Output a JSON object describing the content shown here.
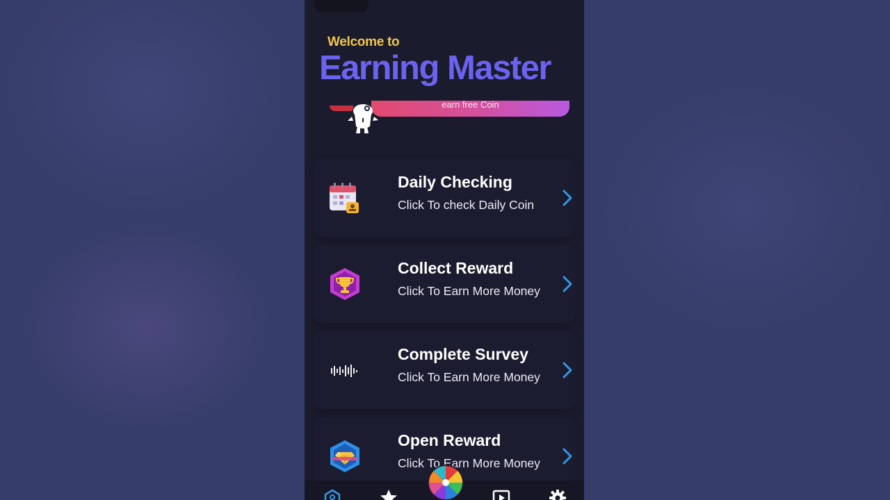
{
  "header": {
    "welcome": "Welcome to",
    "title": "Earning Master"
  },
  "banner": {
    "text": "earn free Coin"
  },
  "menu": [
    {
      "title": "Daily Checking",
      "subtitle": "Click To check Daily Coin",
      "icon": "calendar-icon"
    },
    {
      "title": "Collect Reward",
      "subtitle": "Click To Earn More Money",
      "icon": "trophy-badge-icon"
    },
    {
      "title": "Complete Survey",
      "subtitle": "Click To Earn More Money",
      "icon": "survey-waveform-icon"
    },
    {
      "title": "Open Reward",
      "subtitle": "Click To Earn More Money",
      "icon": "diamond-badge-icon"
    }
  ],
  "bottom_nav": {
    "items": [
      "home-icon",
      "star-icon",
      "spin-wheel-icon",
      "video-play-icon",
      "gear-icon"
    ]
  },
  "colors": {
    "background": "#363d6a",
    "phone_bg": "#1b1b2e",
    "welcome_yellow": "#f0c54a",
    "title_purple": "#6b63f0",
    "chevron_blue": "#2f9be8"
  }
}
